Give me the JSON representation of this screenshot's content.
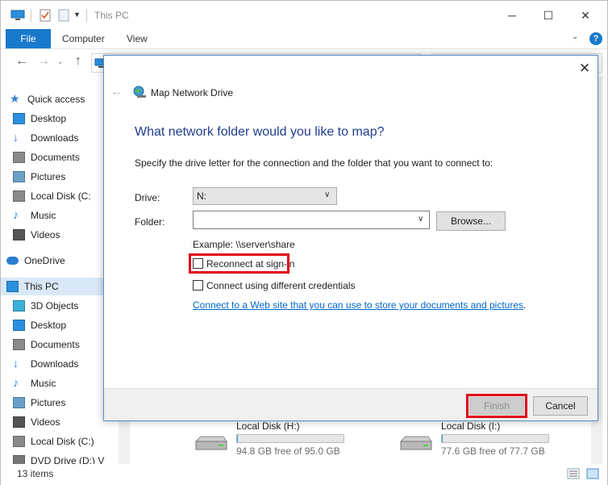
{
  "window": {
    "title": "This PC",
    "minimize_symbol": "─",
    "maximize_symbol": "☐",
    "close_symbol": "✕"
  },
  "ribbon": {
    "tabs": [
      "File",
      "Computer",
      "View"
    ],
    "help_symbol": "?",
    "accent_color": "#1979ca"
  },
  "sidebar": {
    "items": [
      {
        "label": "Quick access",
        "icon": "star-icon"
      },
      {
        "label": "Desktop",
        "icon": "desktop-icon"
      },
      {
        "label": "Downloads",
        "icon": "download-icon"
      },
      {
        "label": "Documents",
        "icon": "documents-icon"
      },
      {
        "label": "Pictures",
        "icon": "pictures-icon"
      },
      {
        "label": "Local Disk (C:",
        "icon": "disk-icon"
      },
      {
        "label": "Music",
        "icon": "music-icon"
      },
      {
        "label": "Videos",
        "icon": "videos-icon"
      },
      {
        "label": "OneDrive",
        "icon": "cloud-icon"
      },
      {
        "label": "This PC",
        "icon": "computer-icon",
        "selected": true
      },
      {
        "label": "3D Objects",
        "icon": "cube-icon"
      },
      {
        "label": "Desktop",
        "icon": "desktop-icon"
      },
      {
        "label": "Documents",
        "icon": "documents-icon"
      },
      {
        "label": "Downloads",
        "icon": "download-icon"
      },
      {
        "label": "Music",
        "icon": "music-icon"
      },
      {
        "label": "Pictures",
        "icon": "pictures-icon"
      },
      {
        "label": "Videos",
        "icon": "videos-icon"
      },
      {
        "label": "Local Disk (C:)",
        "icon": "disk-icon"
      },
      {
        "label": "DVD Drive (D:) V",
        "icon": "dvd-icon"
      }
    ]
  },
  "drives": [
    {
      "name": "Local Disk (H:)",
      "free": "94.8 GB free of 95.0 GB",
      "used_fraction": 0.002
    },
    {
      "name": "Local Disk (I:)",
      "free": "77.6 GB free of 77.7 GB",
      "used_fraction": 0.0013
    }
  ],
  "status": {
    "items_count": "13 items"
  },
  "dialog": {
    "title": "Map Network Drive",
    "close_symbol": "✕",
    "back_symbol": "←",
    "heading": "What network folder would you like to map?",
    "instruction": "Specify the drive letter for the connection and the folder that you want to connect to:",
    "drive_label": "Drive:",
    "drive_value": "N:",
    "folder_label": "Folder:",
    "folder_value": "",
    "browse_label": "Browse...",
    "example": "Example: \\\\server\\share",
    "reconnect_label": "Reconnect at sign-in",
    "reconnect_checked": false,
    "credentials_label": "Connect using different credentials",
    "credentials_checked": false,
    "web_link": "Connect to a Web site that you can use to store your documents and pictures",
    "web_link_suffix": ".",
    "finish_label": "Finish",
    "finish_enabled": false,
    "cancel_label": "Cancel",
    "heading_color": "#1e3d8f",
    "highlight_color": "#e0001a",
    "link_color": "#0066cc"
  }
}
